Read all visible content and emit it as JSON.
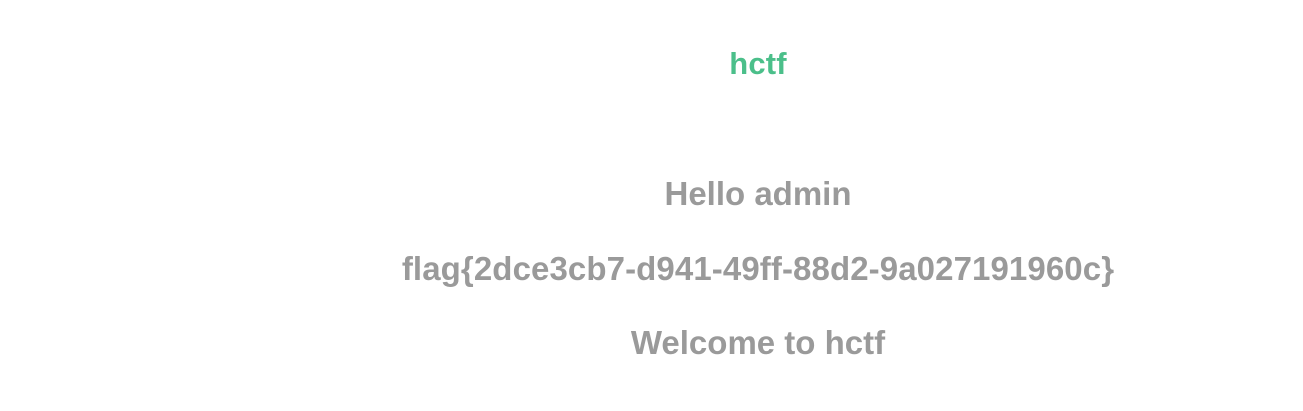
{
  "header": {
    "brand": "hctf",
    "brand_color": "#4bbf8a"
  },
  "main": {
    "greeting": "Hello admin",
    "flag": "flag{2dce3cb7-d941-49ff-88d2-9a027191960c}",
    "welcome": "Welcome to hctf",
    "text_color": "#9a9a9a"
  }
}
